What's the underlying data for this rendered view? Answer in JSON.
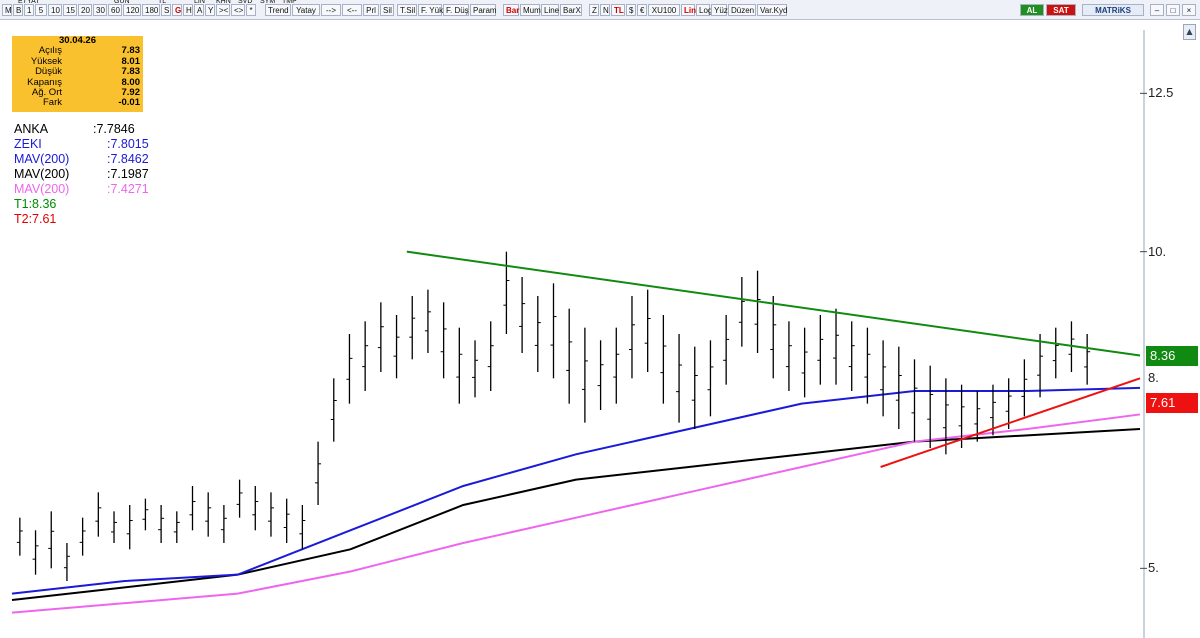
{
  "toolbar": {
    "items": [
      "M",
      "B",
      "1",
      "5",
      "10",
      "15",
      "20",
      "30",
      "60",
      "120",
      "180",
      "S",
      "G",
      "H",
      "A",
      "Y",
      "><",
      "<>",
      "*",
      "Trend",
      "Yatay",
      "-->",
      "<--",
      "Prl",
      "Sil",
      "T.Sil",
      "F. Yük",
      "F. Düş",
      "Param",
      "Bar",
      "Mum",
      "Line",
      "BarX",
      "Z",
      "N",
      "TL",
      "$",
      "€",
      "XU100",
      "Lin",
      "Log",
      "Yüz",
      "Düzen",
      "Var.Kyd"
    ],
    "symbol": "ETYAT",
    "period": "GUN",
    "currency": "TL",
    "row1": [
      "LIN",
      "KHN",
      "SVD",
      "SYM",
      "TMP"
    ],
    "al_label": "AL",
    "sat_label": "SAT",
    "brand": "MATRiKS"
  },
  "ohlc_box": {
    "date": "30.04.26",
    "rows": [
      {
        "k": "Açılış",
        "v": "7.83"
      },
      {
        "k": "Yüksek",
        "v": "8.01"
      },
      {
        "k": "Düşük",
        "v": "7.83"
      },
      {
        "k": "Kapanış",
        "v": "8.00"
      },
      {
        "k": "Ağ. Ort",
        "v": "7.92"
      },
      {
        "k": "Fark",
        "v": "-0.01"
      }
    ]
  },
  "legend": [
    {
      "name": "ANKA",
      "value": ":7.7846",
      "color": "#000000"
    },
    {
      "name": "ZEKI",
      "value": ":7.8015",
      "color": "#1a1ad8"
    },
    {
      "name": "MAV(200)",
      "value": ":7.8462",
      "color": "#1a1ad8"
    },
    {
      "name": "MAV(200)",
      "value": ":7.1987",
      "color": "#000000"
    },
    {
      "name": "MAV(200)",
      "value": ":7.4271",
      "color": "#ee66ee"
    },
    {
      "name": "T1:8.36",
      "value": "",
      "color": "#008a00"
    },
    {
      "name": "T2:7.61",
      "value": "",
      "color": "#e00000"
    }
  ],
  "tags": {
    "t1": {
      "label": "8.36",
      "value": 8.36,
      "color": "#108a10"
    },
    "t2": {
      "label": "7.61",
      "value": 7.61,
      "color": "#ee1111"
    },
    "last_price_label": "8."
  },
  "chart_data": {
    "type": "bar",
    "style": "OHLC bars",
    "ylim": [
      3.9,
      13.5
    ],
    "y_ticks": [
      {
        "value": 12.5,
        "label": "12.5"
      },
      {
        "value": 10,
        "label": "10."
      },
      {
        "value": 5,
        "label": "5."
      }
    ],
    "grid": false,
    "bars_high": [
      5.8,
      5.6,
      5.9,
      5.4,
      5.8,
      6.2,
      5.9,
      6.0,
      6.1,
      6.0,
      5.9,
      6.3,
      6.2,
      6.0,
      6.4,
      6.3,
      6.2,
      6.1,
      6.0,
      7.0,
      8.0,
      8.7,
      8.9,
      9.2,
      9.0,
      9.3,
      9.4,
      9.2,
      8.8,
      8.6,
      8.9,
      10.0,
      9.6,
      9.3,
      9.5,
      9.1,
      8.8,
      8.6,
      8.8,
      9.3,
      9.4,
      9.0,
      8.7,
      8.5,
      8.6,
      9.0,
      9.6,
      9.7,
      9.3,
      8.9,
      8.8,
      9.0,
      9.1,
      8.9,
      8.8,
      8.6,
      8.5,
      8.3,
      8.2,
      8.0,
      7.9,
      7.8,
      7.9,
      8.0,
      8.3,
      8.7,
      8.8,
      8.9,
      8.7
    ],
    "bars_low": [
      5.2,
      4.9,
      5.0,
      4.8,
      5.2,
      5.5,
      5.4,
      5.3,
      5.6,
      5.4,
      5.4,
      5.6,
      5.5,
      5.4,
      5.8,
      5.6,
      5.5,
      5.4,
      5.3,
      6.0,
      7.0,
      7.6,
      7.8,
      8.1,
      8.0,
      8.3,
      8.4,
      8.0,
      7.6,
      7.7,
      7.8,
      8.7,
      8.4,
      8.1,
      8.0,
      7.6,
      7.3,
      7.5,
      7.6,
      8.0,
      8.1,
      7.6,
      7.3,
      7.2,
      7.4,
      7.9,
      8.5,
      8.4,
      8.0,
      7.8,
      7.7,
      7.9,
      7.9,
      7.8,
      7.6,
      7.4,
      7.2,
      7.0,
      6.9,
      6.8,
      6.9,
      7.0,
      7.1,
      7.2,
      7.4,
      7.7,
      8.0,
      8.1,
      7.9
    ],
    "series": [
      {
        "name": "MAV(200)",
        "color": "#000000",
        "x": [
          0,
          0.1,
          0.2,
          0.3,
          0.4,
          0.5,
          0.6,
          0.7,
          0.8,
          0.9,
          1.0
        ],
        "y": [
          4.5,
          4.7,
          4.9,
          5.3,
          6.0,
          6.4,
          6.6,
          6.8,
          7.0,
          7.1,
          7.2
        ]
      },
      {
        "name": "MAV(200)",
        "color": "#1a1ad8",
        "x": [
          0,
          0.1,
          0.2,
          0.3,
          0.4,
          0.5,
          0.6,
          0.7,
          0.8,
          0.9,
          1.0
        ],
        "y": [
          4.6,
          4.8,
          4.9,
          5.6,
          6.3,
          6.8,
          7.2,
          7.6,
          7.8,
          7.8,
          7.85
        ]
      },
      {
        "name": "MAV(200)",
        "color": "#ee66ee",
        "x": [
          0,
          0.1,
          0.2,
          0.3,
          0.4,
          0.5,
          0.6,
          0.7,
          0.8,
          0.9,
          1.0
        ],
        "y": [
          4.3,
          4.45,
          4.6,
          4.95,
          5.4,
          5.8,
          6.2,
          6.6,
          7.0,
          7.2,
          7.43
        ]
      }
    ],
    "trendlines": [
      {
        "name": "T1",
        "color": "#108a10",
        "from": [
          0.35,
          10.0
        ],
        "to": [
          1.0,
          8.36
        ]
      },
      {
        "name": "T2",
        "color": "#ee1111",
        "from": [
          0.77,
          6.6
        ],
        "to": [
          1.0,
          8.0
        ]
      }
    ]
  }
}
